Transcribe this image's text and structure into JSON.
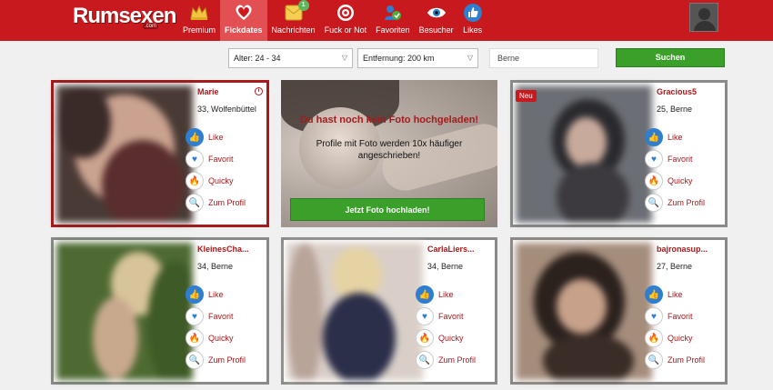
{
  "header": {
    "logo_text": "Rumsexen",
    "logo_suffix": ".com",
    "nav": [
      {
        "label": "Premium",
        "icon": "crown-icon"
      },
      {
        "label": "Fickdates",
        "icon": "heart-icon",
        "active": true
      },
      {
        "label": "Nachrichten",
        "icon": "message-icon",
        "badge": "1"
      },
      {
        "label": "Fuck or Not",
        "icon": "target-icon"
      },
      {
        "label": "Favoriten",
        "icon": "favorites-icon"
      },
      {
        "label": "Besucher",
        "icon": "eye-icon"
      },
      {
        "label": "Likes",
        "icon": "thumbs-up-icon"
      }
    ]
  },
  "filters": {
    "age": "Alter: 24 - 34",
    "distance": "Entfernung: 200 km",
    "location": "Berne",
    "search_button": "Suchen"
  },
  "actions": {
    "like": "Like",
    "favorite": "Favorit",
    "quicky": "Quicky",
    "profile": "Zum Profil"
  },
  "promo": {
    "headline": "Du hast noch kein Foto hochgeladen!",
    "text": "Profile mit Foto werden 10x häufiger angeschrieben!",
    "button": "Jetzt Foto hochladen!"
  },
  "profiles": [
    {
      "name": "Marie",
      "meta": "33, Wolfenbüttel",
      "info": "i"
    },
    {
      "name": "Gracious5",
      "meta": "25, Berne",
      "new": "Neu"
    },
    {
      "name": "KleinesCha...",
      "meta": "34, Berne"
    },
    {
      "name": "CarlaLiers...",
      "meta": "34, Berne"
    },
    {
      "name": "bajronasup...",
      "meta": "27, Berne"
    }
  ]
}
